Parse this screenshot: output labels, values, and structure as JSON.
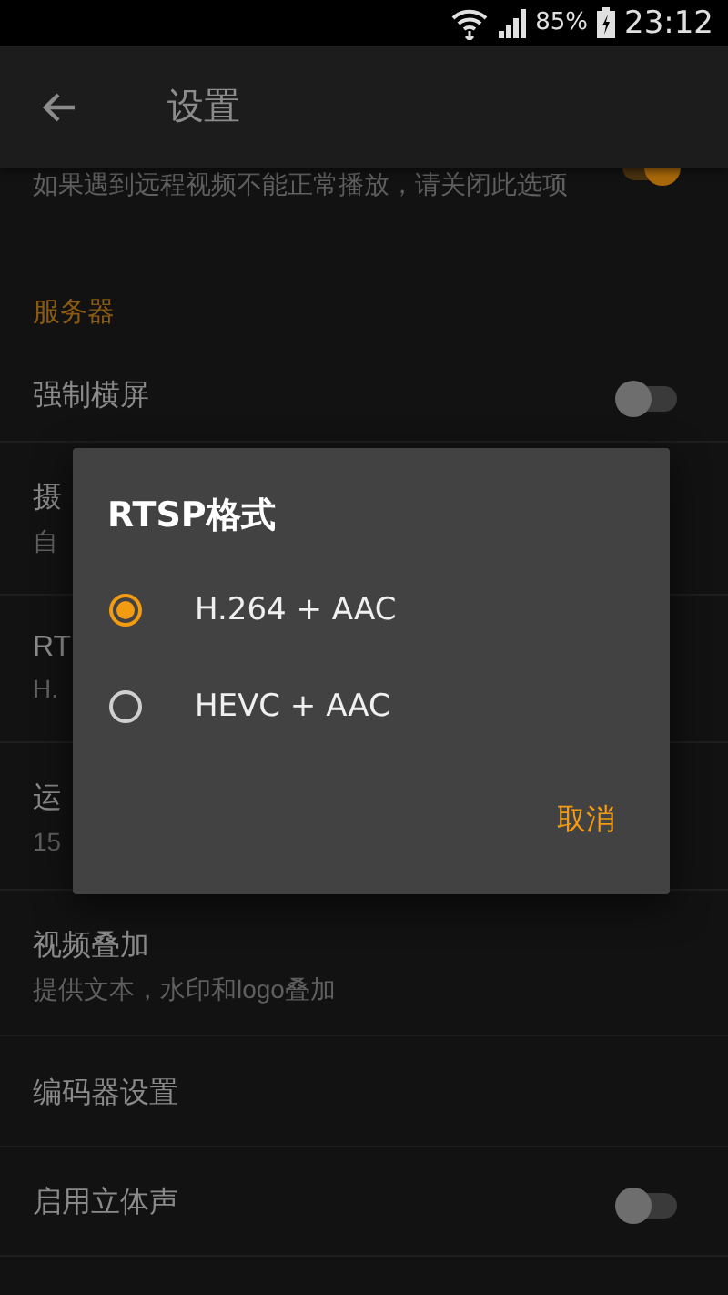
{
  "status_bar": {
    "battery": "85%",
    "time": "23:12"
  },
  "app_bar": {
    "title": "设置"
  },
  "settings": [
    {
      "kind": "switch",
      "subtitle": "如果遇到远程视频不能正常播放，请关闭此选项",
      "on": true
    },
    {
      "kind": "header",
      "title": "服务器"
    },
    {
      "kind": "switch",
      "title": "强制横屏",
      "on": false
    },
    {
      "kind": "item",
      "title": "摄",
      "subtitle": "自"
    },
    {
      "kind": "item",
      "title": "RT",
      "subtitle": "H."
    },
    {
      "kind": "item",
      "title": "运",
      "subtitle": "15"
    },
    {
      "kind": "item",
      "title": "视频叠加",
      "subtitle": "提供文本，水印和logo叠加"
    },
    {
      "kind": "item",
      "title": "编码器设置"
    },
    {
      "kind": "switch",
      "title": "启用立体声",
      "on": false
    }
  ],
  "dialog": {
    "title": "RTSP格式",
    "options": [
      {
        "label": "H.264 + AAC",
        "selected": true
      },
      {
        "label": "HEVC + AAC",
        "selected": false
      }
    ],
    "button": "取消"
  }
}
